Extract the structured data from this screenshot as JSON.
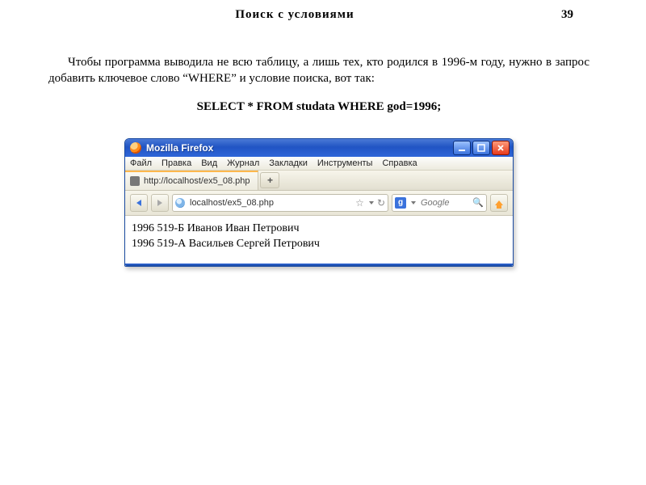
{
  "header": {
    "title": "Поиск  с  условиями",
    "page_num": "39"
  },
  "paragraph": "Чтобы  программа выводила  не  всю  таблицу,   а  лишь  тех,  кто родился в 1996-м году, нужно в запрос добавить ключевое слово “WHERE” и условие поиска, вот так:",
  "sql": "SELECT * FROM studata WHERE god=1996;",
  "browser": {
    "window_title": "Mozilla Firefox",
    "menu": {
      "file": "Файл",
      "edit": "Правка",
      "view": "Вид",
      "history": "Журнал",
      "bookmarks": "Закладки",
      "tools": "Инструменты",
      "help": "Справка"
    },
    "tab": {
      "title": "http://localhost/ex5_08.php"
    },
    "newtab_label": "+",
    "address": "localhost/ex5_08.php",
    "search_engine_letter": "g",
    "search_placeholder": "Google",
    "results": [
      "1996 519-Б Иванов Иван Петрович",
      "1996 519-А Васильев Сергей Петрович"
    ]
  }
}
